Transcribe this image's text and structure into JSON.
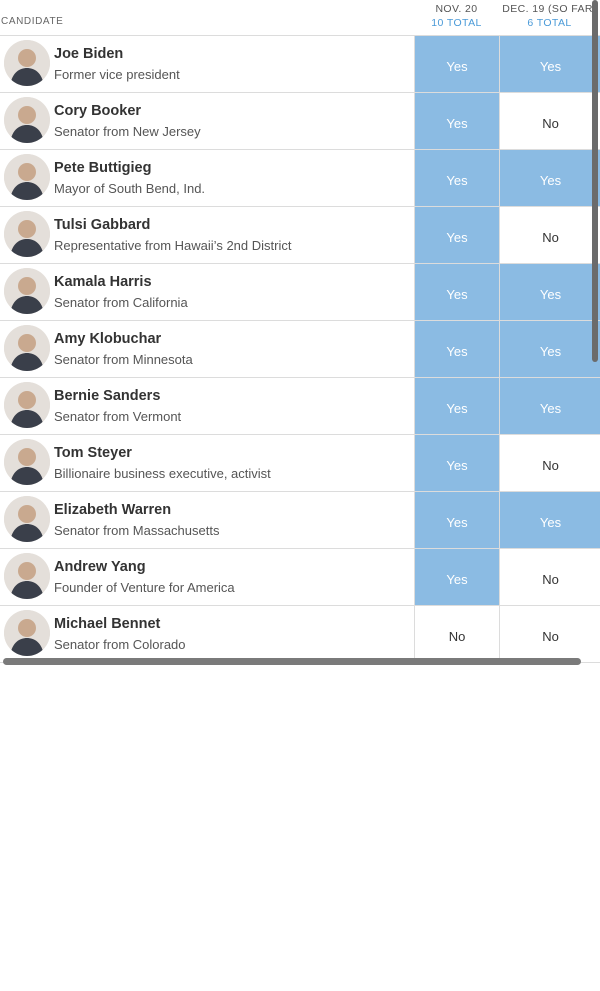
{
  "header": {
    "candidate_label": "CANDIDATE",
    "columns": [
      {
        "date": "NOV. 20",
        "total": "10 TOTAL"
      },
      {
        "date": "DEC. 19 (SO FAR)",
        "total": "6 TOTAL"
      }
    ]
  },
  "colors": {
    "yes_cell": "#8bbbe3",
    "total_text": "#4a9ad8"
  },
  "rows": [
    {
      "name": "Joe Biden",
      "title": "Former vice president",
      "nov": "Yes",
      "dec": "Yes"
    },
    {
      "name": "Cory Booker",
      "title": "Senator from New Jersey",
      "nov": "Yes",
      "dec": "No"
    },
    {
      "name": "Pete Buttigieg",
      "title": "Mayor of South Bend, Ind.",
      "nov": "Yes",
      "dec": "Yes"
    },
    {
      "name": "Tulsi Gabbard",
      "title": "Representative from Hawaii’s 2nd District",
      "nov": "Yes",
      "dec": "No"
    },
    {
      "name": "Kamala Harris",
      "title": "Senator from California",
      "nov": "Yes",
      "dec": "Yes"
    },
    {
      "name": "Amy Klobuchar",
      "title": "Senator from Minnesota",
      "nov": "Yes",
      "dec": "Yes"
    },
    {
      "name": "Bernie Sanders",
      "title": "Senator from Vermont",
      "nov": "Yes",
      "dec": "Yes"
    },
    {
      "name": "Tom Steyer",
      "title": "Billionaire business executive, activist",
      "nov": "Yes",
      "dec": "No"
    },
    {
      "name": "Elizabeth Warren",
      "title": "Senator from Massachusetts",
      "nov": "Yes",
      "dec": "Yes"
    },
    {
      "name": "Andrew Yang",
      "title": "Founder of Venture for America",
      "nov": "Yes",
      "dec": "No"
    },
    {
      "name": "Michael Bennet",
      "title": "Senator from Colorado",
      "nov": "No",
      "dec": "No"
    }
  ]
}
